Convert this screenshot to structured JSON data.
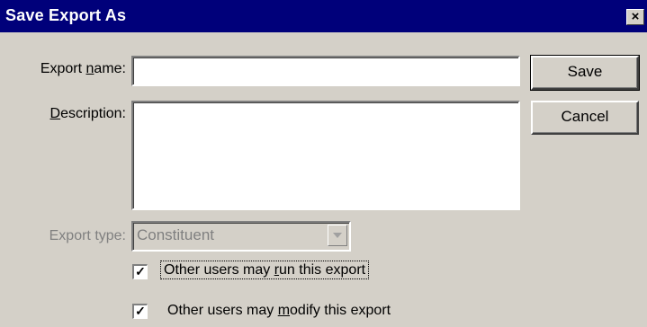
{
  "window": {
    "title": "Save Export As",
    "close_glyph": "×"
  },
  "form": {
    "export_name": {
      "label_pre": "Export ",
      "label_key": "n",
      "label_post": "ame:",
      "value": ""
    },
    "description": {
      "label_pre": "",
      "label_key": "D",
      "label_post": "escription:",
      "value": ""
    },
    "export_type": {
      "label": "Export type:",
      "selected": "Constituent",
      "disabled": true
    }
  },
  "buttons": {
    "save": "Save",
    "cancel": "Cancel"
  },
  "options": {
    "run": {
      "checked": true,
      "label_pre": "Other users may ",
      "label_key": "r",
      "label_post": "un this export"
    },
    "modify": {
      "checked": true,
      "label_pre": "Other users may ",
      "label_key": "m",
      "label_post": "odify this export"
    }
  },
  "icons": {
    "checkbox_check": "check-icon",
    "dropdown": "chevron-down-icon",
    "close": "close-icon"
  },
  "colors": {
    "titlebar": "#00007a",
    "face": "#d4d0c8",
    "disabled_text": "#808080"
  }
}
